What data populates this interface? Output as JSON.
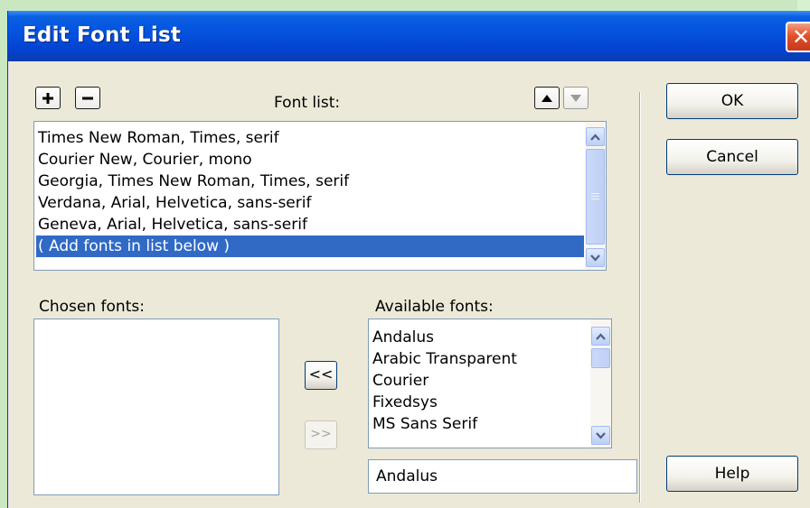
{
  "dialog": {
    "title": "Edit Font List",
    "close_glyph": "✕"
  },
  "font_list": {
    "label": "Font list:",
    "add_glyph": "+",
    "remove_glyph": "−",
    "items": [
      "Times New Roman, Times, serif",
      "Courier New, Courier, mono",
      "Georgia, Times New Roman, Times, serif",
      "Verdana, Arial, Helvetica, sans-serif",
      "Geneva, Arial, Helvetica, sans-serif",
      "( Add fonts in list below )"
    ],
    "selected_index": 5
  },
  "chosen_fonts": {
    "label": "Chosen fonts:",
    "items": []
  },
  "transfer": {
    "add_label": "<<",
    "remove_label": ">>"
  },
  "available_fonts": {
    "label": "Available fonts:",
    "items": [
      "Andalus",
      "Arabic Transparent",
      "Courier",
      "Fixedsys",
      "MS Sans Serif"
    ],
    "input_value": "Andalus"
  },
  "buttons": {
    "ok": "OK",
    "cancel": "Cancel",
    "help": "Help"
  },
  "icons": {
    "add": "plus-icon",
    "remove": "minus-icon",
    "move_up": "triangle-up-icon",
    "move_down": "triangle-down-icon",
    "scroll_up": "chevron-up-icon",
    "scroll_down": "chevron-down-icon"
  },
  "colors": {
    "title_bar": "#0553e0",
    "selection": "#316ac5",
    "dialog_bg": "#ece9d8",
    "close_button": "#e2512a"
  }
}
